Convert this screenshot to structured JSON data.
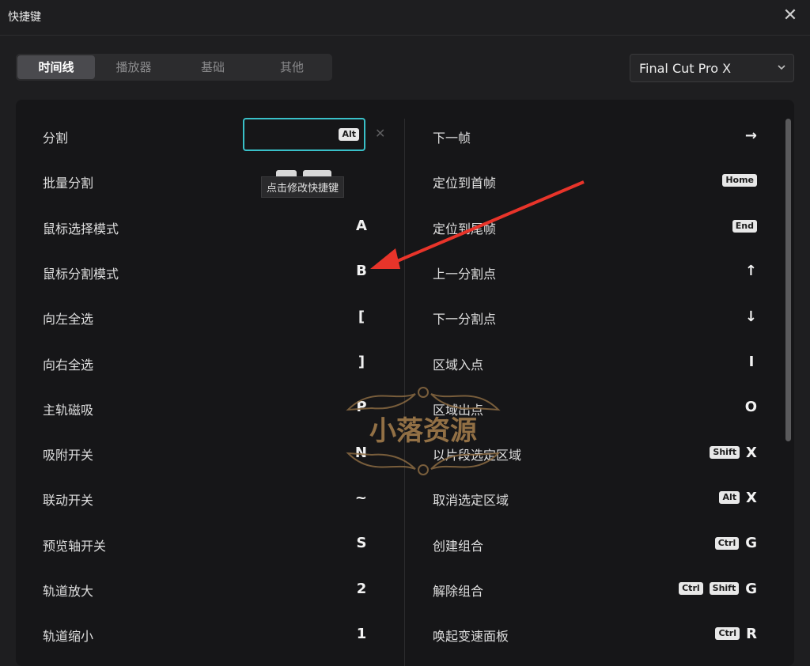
{
  "window": {
    "title": "快捷键"
  },
  "tabs": [
    {
      "label": "时间线",
      "active": true
    },
    {
      "label": "播放器",
      "active": false
    },
    {
      "label": "基础",
      "active": false
    },
    {
      "label": "其他",
      "active": false
    }
  ],
  "preset": {
    "selected": "Final Cut Pro X"
  },
  "tooltip": "点击修改快捷键",
  "left_shortcuts": [
    {
      "label": "分割",
      "keys": [
        "Alt"
      ],
      "editing": true
    },
    {
      "label": "批量分割",
      "keys": []
    },
    {
      "label": "鼠标选择模式",
      "keys": [
        "A"
      ]
    },
    {
      "label": "鼠标分割模式",
      "keys": [
        "B"
      ]
    },
    {
      "label": "向左全选",
      "keys": [
        "["
      ]
    },
    {
      "label": "向右全选",
      "keys": [
        "]"
      ]
    },
    {
      "label": "主轨磁吸",
      "keys": [
        "P"
      ]
    },
    {
      "label": "吸附开关",
      "keys": [
        "N"
      ]
    },
    {
      "label": "联动开关",
      "keys": [
        "~"
      ]
    },
    {
      "label": "预览轴开关",
      "keys": [
        "S"
      ]
    },
    {
      "label": "轨道放大",
      "keys": [
        "2"
      ]
    },
    {
      "label": "轨道缩小",
      "keys": [
        "1"
      ]
    }
  ],
  "right_shortcuts": [
    {
      "label": "下一帧",
      "keys": [
        "→"
      ]
    },
    {
      "label": "定位到首帧",
      "keys": [
        "Home"
      ]
    },
    {
      "label": "定位到尾帧",
      "keys": [
        "End"
      ]
    },
    {
      "label": "上一分割点",
      "keys": [
        "↑"
      ]
    },
    {
      "label": "下一分割点",
      "keys": [
        "↓"
      ]
    },
    {
      "label": "区域入点",
      "keys": [
        "I"
      ]
    },
    {
      "label": "区域出点",
      "keys": [
        "O"
      ]
    },
    {
      "label": "以片段选定区域",
      "keys": [
        "Shift",
        "X"
      ]
    },
    {
      "label": "取消选定区域",
      "keys": [
        "Alt",
        "X"
      ]
    },
    {
      "label": "创建组合",
      "keys": [
        "Ctrl",
        "G"
      ]
    },
    {
      "label": "解除组合",
      "keys": [
        "Ctrl",
        "Shift",
        "G"
      ]
    },
    {
      "label": "唤起变速面板",
      "keys": [
        "Ctrl",
        "R"
      ]
    }
  ],
  "watermark": {
    "text": "小落资源"
  },
  "colors": {
    "accent": "#39c0c8",
    "arrow": "#e8342a",
    "watermark": "#a07a4a"
  },
  "icons": {
    "close": "close-icon",
    "select": "chevron-down-icon",
    "clear": "clear-icon"
  }
}
